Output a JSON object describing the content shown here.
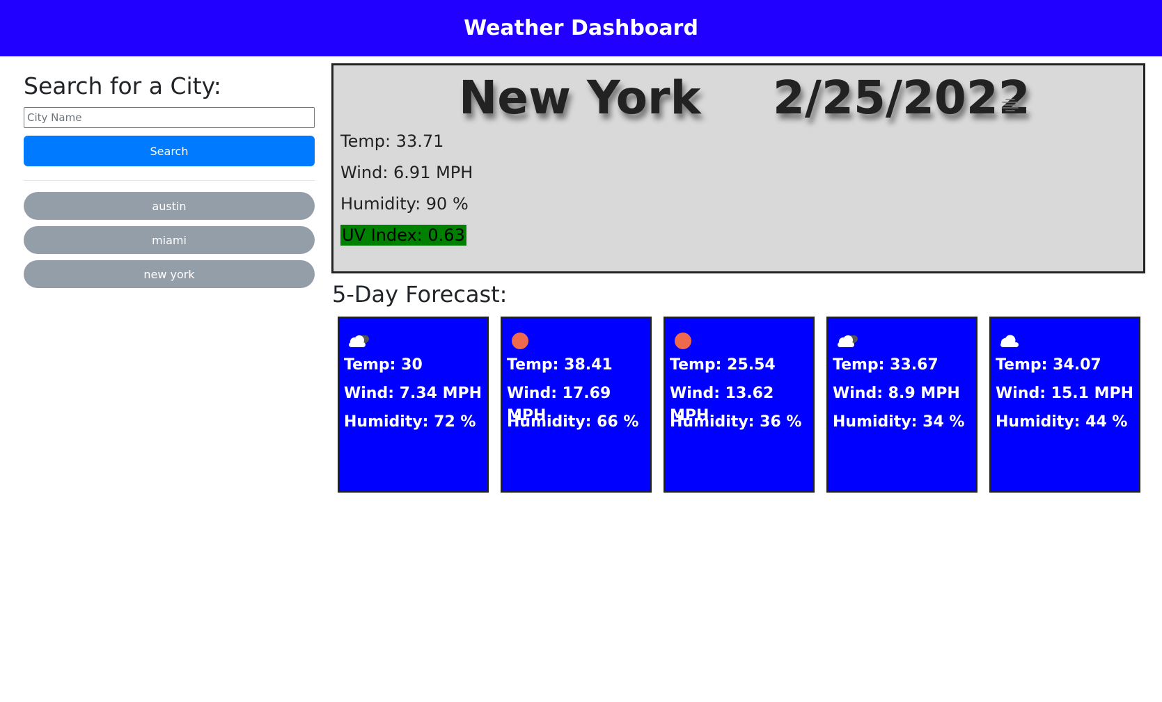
{
  "header": {
    "title": "Weather Dashboard"
  },
  "sidebar": {
    "title": "Search for a City:",
    "input_placeholder": "City Name",
    "search_label": "Search",
    "history": [
      "austin",
      "miami",
      "new york"
    ]
  },
  "current": {
    "city": "New York",
    "date": "2/25/2022",
    "icon": "mist-icon",
    "temp": "Temp: 33.71",
    "wind": "Wind: 6.91 MPH",
    "humidity": "Humidity: 90 %",
    "uv": "UV Index: 0.63",
    "uv_color": "#008000"
  },
  "forecast": {
    "title": "5-Day Forecast:",
    "days": [
      {
        "icon": "broken-clouds-icon",
        "temp": "Temp: 30",
        "wind": "Wind: 7.34 MPH",
        "humidity": "Humidity: 72 %"
      },
      {
        "icon": "clear-sun-icon",
        "temp": "Temp: 38.41",
        "wind": "Wind: 17.69 MPH",
        "humidity": "Humidity: 66 %"
      },
      {
        "icon": "clear-sun-icon",
        "temp": "Temp: 25.54",
        "wind": "Wind: 13.62 MPH",
        "humidity": "Humidity: 36 %"
      },
      {
        "icon": "broken-clouds-icon",
        "temp": "Temp: 33.67",
        "wind": "Wind: 8.9 MPH",
        "humidity": "Humidity: 34 %"
      },
      {
        "icon": "cloud-icon",
        "temp": "Temp: 34.07",
        "wind": "Wind: 15.1 MPH",
        "humidity": "Humidity: 44 %"
      }
    ]
  },
  "colors": {
    "header_bg": "#2200ff",
    "card_bg": "#0000ff",
    "search_btn": "#007bff",
    "history_btn": "#949ea9",
    "current_bg": "#d9d9d9"
  }
}
